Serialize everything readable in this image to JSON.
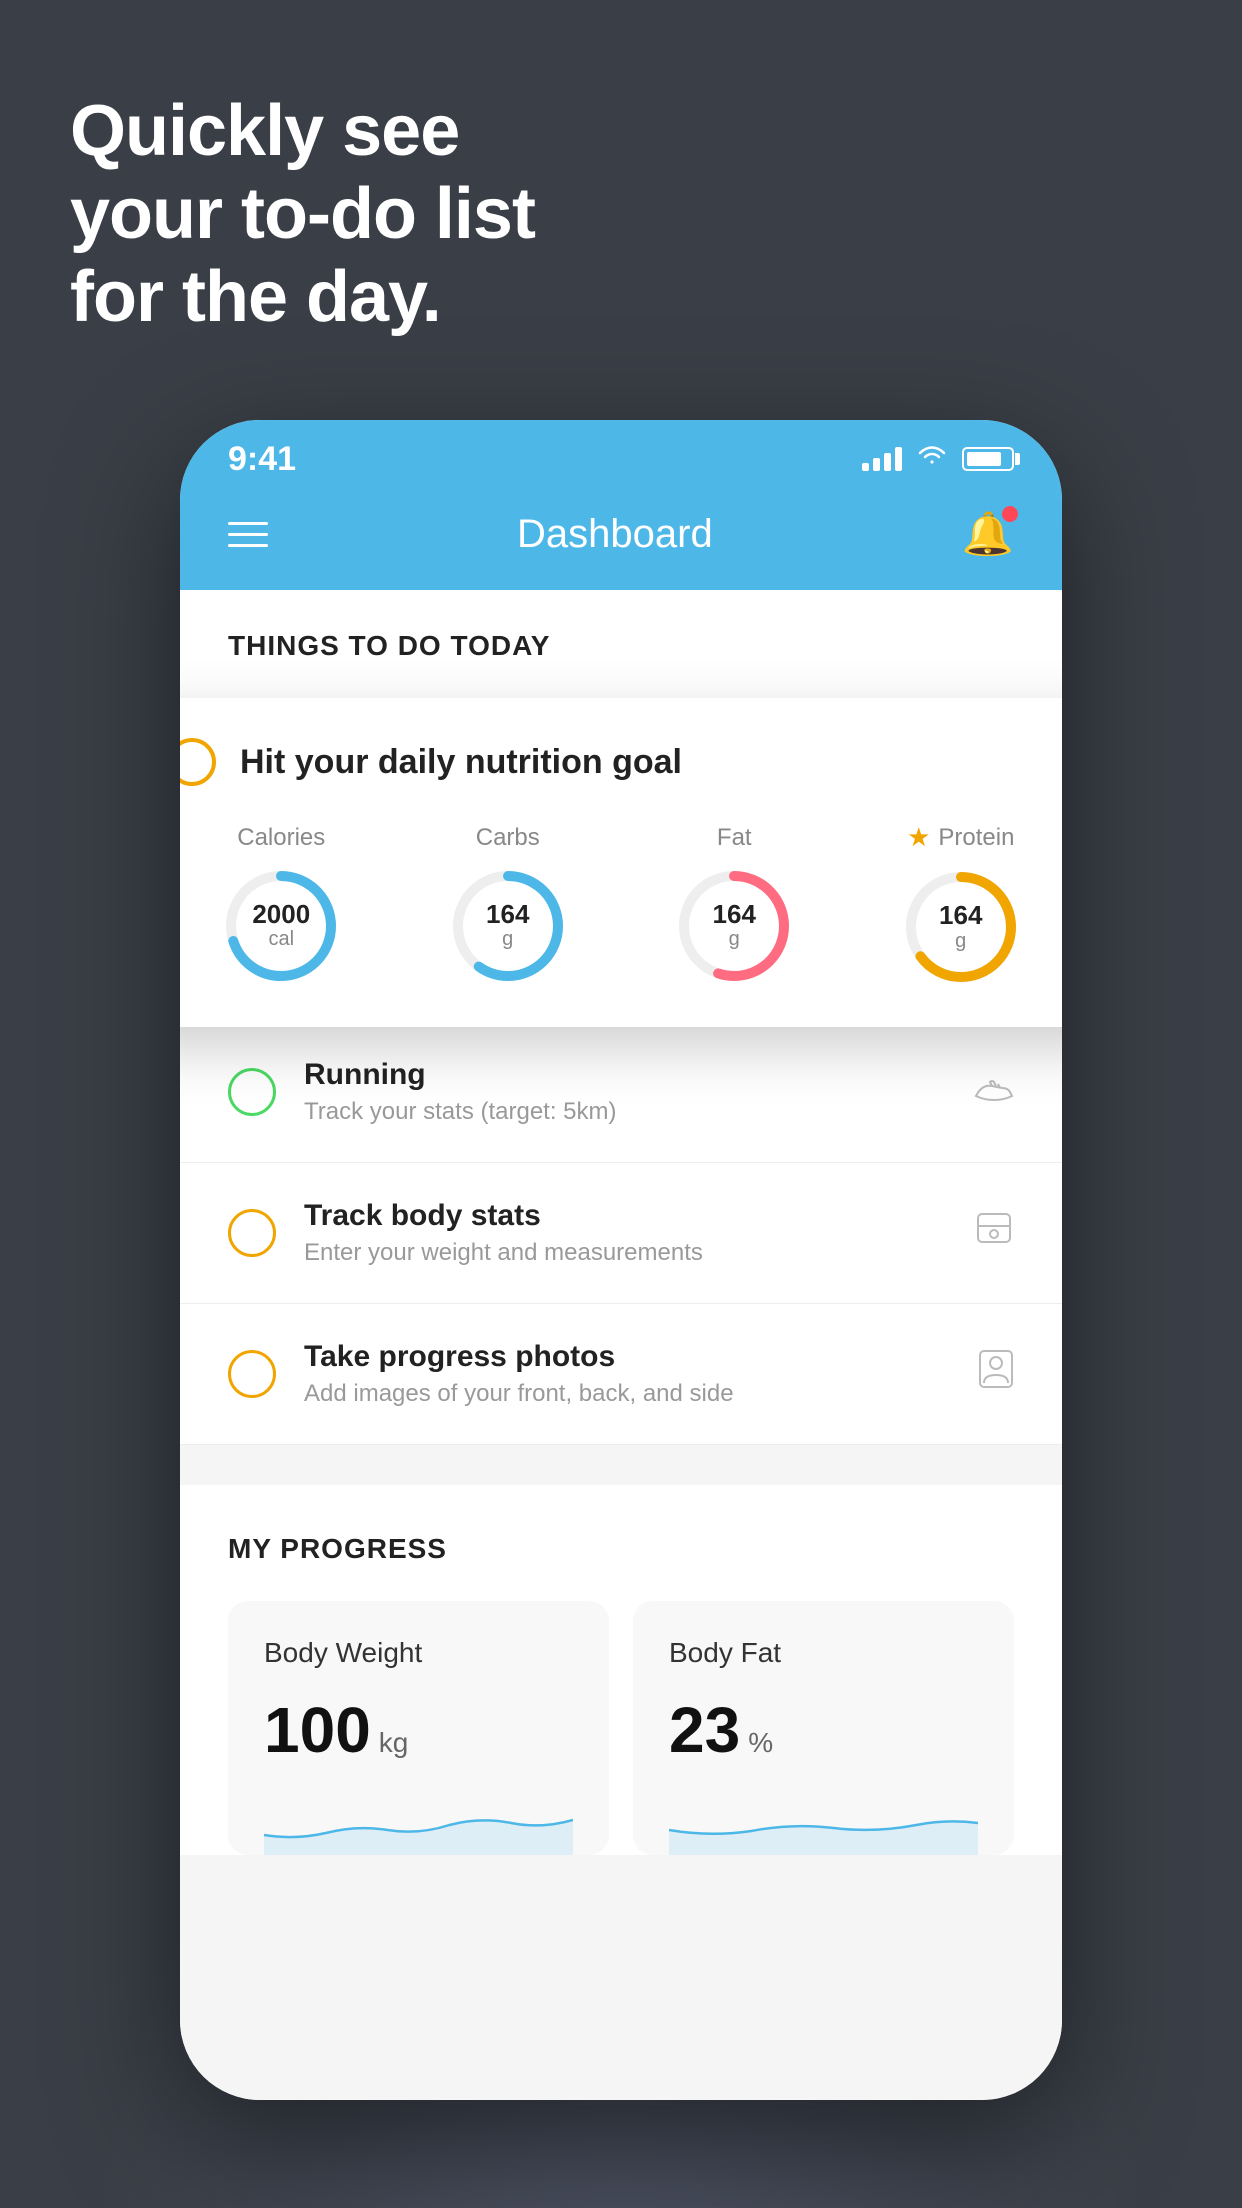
{
  "background_color": "#3a3f47",
  "headline": {
    "line1": "Quickly see",
    "line2": "your to-do list",
    "line3": "for the day."
  },
  "status_bar": {
    "time": "9:41"
  },
  "app_header": {
    "title": "Dashboard"
  },
  "things_section": {
    "title": "THINGS TO DO TODAY"
  },
  "featured_card": {
    "title": "Hit your daily nutrition goal",
    "nutrition_items": [
      {
        "label": "Calories",
        "value": "2000",
        "unit": "cal",
        "color": "#4db8e8",
        "percentage": 70,
        "starred": false
      },
      {
        "label": "Carbs",
        "value": "164",
        "unit": "g",
        "color": "#4db8e8",
        "percentage": 60,
        "starred": false
      },
      {
        "label": "Fat",
        "value": "164",
        "unit": "g",
        "color": "#ff6b81",
        "percentage": 55,
        "starred": false
      },
      {
        "label": "Protein",
        "value": "164",
        "unit": "g",
        "color": "#f0a500",
        "percentage": 65,
        "starred": true
      }
    ]
  },
  "todo_items": [
    {
      "id": "running",
      "title": "Running",
      "subtitle": "Track your stats (target: 5km)",
      "circle_color": "green",
      "icon": "shoe"
    },
    {
      "id": "track-body-stats",
      "title": "Track body stats",
      "subtitle": "Enter your weight and measurements",
      "circle_color": "yellow",
      "icon": "scale"
    },
    {
      "id": "progress-photos",
      "title": "Take progress photos",
      "subtitle": "Add images of your front, back, and side",
      "circle_color": "yellow",
      "icon": "person"
    }
  ],
  "progress_section": {
    "title": "MY PROGRESS",
    "cards": [
      {
        "id": "body-weight",
        "title": "Body Weight",
        "value": "100",
        "unit": "kg"
      },
      {
        "id": "body-fat",
        "title": "Body Fat",
        "value": "23",
        "unit": "%"
      }
    ]
  }
}
